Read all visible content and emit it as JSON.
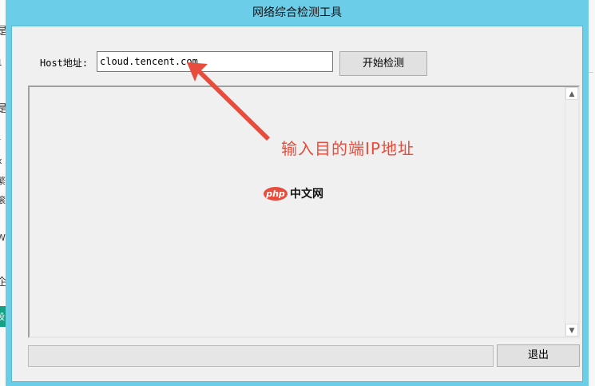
{
  "window": {
    "title": "网络综合检测工具"
  },
  "host": {
    "label": "Host地址:",
    "value": "cloud.tencent.com"
  },
  "buttons": {
    "start": "开始检测",
    "exit": "退出"
  },
  "output": {
    "scroll_up": "▲",
    "scroll_down": "▼"
  },
  "annotation": {
    "text": "输入目的端IP地址",
    "color": "#e74c3c"
  },
  "watermark": {
    "badge": "php",
    "text": "中文网"
  },
  "background_fragments": [
    "是",
    "1",
    "是",
    "r",
    "x",
    "繁",
    "滚",
    "W",
    "企",
    "设"
  ],
  "colors": {
    "titlebar": "#6ccde9",
    "client": "#f0f0f0",
    "accent": "#e74c3c"
  }
}
